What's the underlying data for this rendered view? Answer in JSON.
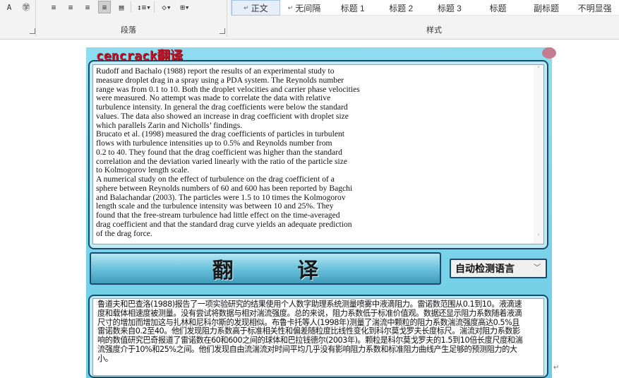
{
  "ribbon": {
    "paragraph_group_label": "段落",
    "styles_group_label": "样式",
    "styles": [
      {
        "mark": "↵",
        "label": "正文",
        "selected": true
      },
      {
        "mark": "↵",
        "label": "无间隔",
        "selected": false
      },
      {
        "mark": "",
        "label": "标题 1",
        "selected": false
      },
      {
        "mark": "",
        "label": "标题 2",
        "selected": false
      },
      {
        "mark": "",
        "label": "标题 3",
        "selected": false
      },
      {
        "mark": "",
        "label": "标题",
        "selected": false
      },
      {
        "mark": "",
        "label": "副标题",
        "selected": false
      },
      {
        "mark": "",
        "label": "不明显强",
        "selected": false
      }
    ]
  },
  "app": {
    "title": "cencrack翻译",
    "source_text": "Rudoff and Bachalo (1988) report the results of an experimental study to\nmeasure droplet drag in a spray using a PDA system. The Reynolds number\nrange was from 0.1 to 10. Both the droplet velocities and carrier phase velocities\nwere measured. No attempt was made to correlate the data with relative\nturbulence intensity. In general the drag coefficients were below the standard\nvalues. The data also showed an increase in drag coefficient with droplet size\nwhich parallels Zarin and Nicholls’ findings.\nBrucato et al. (1998) measured the drag coefficients of particles in turbulent\nflows with turbulence intensities up to 0.5% and Reynolds number from\n0.2 to 40. They found that the drag coefficient was higher than the standard\ncorrelation and the deviation varied linearly with the ratio of the particle size\nto Kolmogorov length scale.\nA numerical study on the effect of turbulence on the drag coefficient of a\nsphere between Reynolds numbers of 60 and 600 has been reported by Bagchi\nand Balachandar (2003). The particles were 1.5 to 10 times the Kolmogorov\nlength scale and the turbulence intensity was between 10 and 25%. They\nfound that the free-stream turbulence had little effect on the time-averaged\ndrag coefficient and that the standard drag curve yields an adequate prediction\nof the drag force.",
    "translate_button_label": "翻 译",
    "language_select_value": "自动检测语言",
    "result_text": "鲁道夫和巴查洛(1988)报告了一项实验研究的结果使用个人数字助理系统测量喷雾中液滴阻力。雷诺数范围从0.1到10。液滴速度和载体相速度被测量。没有尝试将数据与相对湍流强度。总的来说，阻力系数低于标准价值观。数据还显示阻力系数随着液滴尺寸的增加而增加这与扎林和尼科尔斯的发现相似。布鲁卡托等人(1998年)测量了湍流中颗粒的阻力系数湍流强度高达0.5%且雷诺数来自0.2至40。他们发现阻力系数高于标准相关性和偏差随粒度比线性变化到科尔莫戈罗夫长度标尺。湍流对阻力系数影响的数值研究巴奇报道了雷诺数在60和600之间的球体和巴拉钱德尔(2003年)。颗粒是科尔莫戈罗夫的1.5到10倍长度尺度和湍流强度介于10%和25%之间。他们发现自由流湍流对时间平均几乎没有影响阻力系数和标准阻力曲线产生足够的预测阻力的大小。"
  },
  "colors": {
    "app_background": "#6ccde6",
    "panel_border": "#164b6a",
    "title_red": "#c0172b"
  }
}
